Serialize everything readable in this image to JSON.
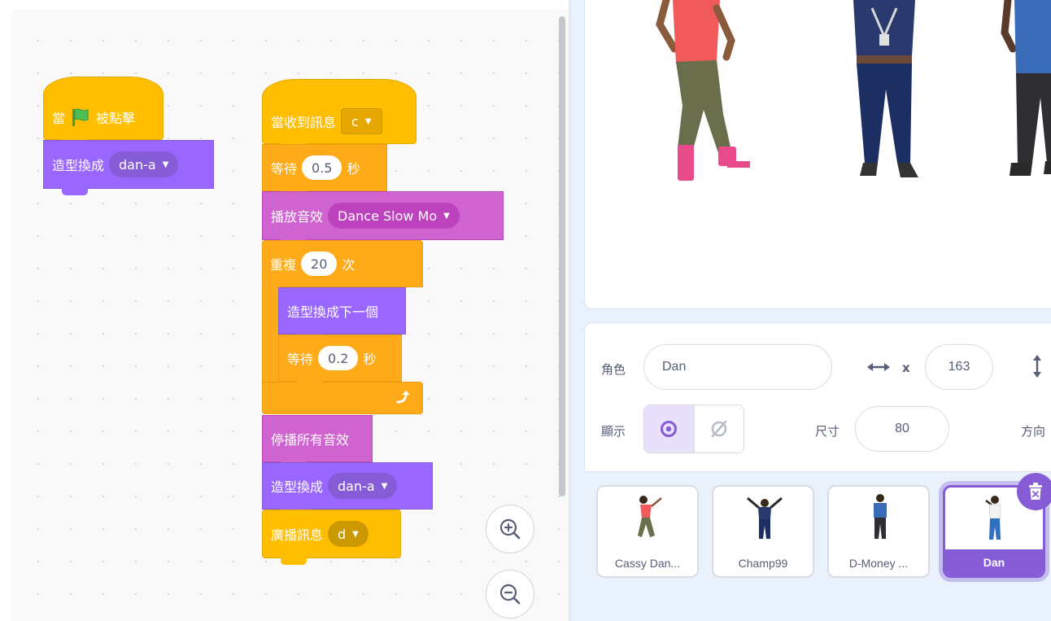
{
  "colors": {
    "events": "#ffbf00",
    "control": "#ffab19",
    "looks": "#9966ff",
    "sound": "#cf63cf",
    "selected": "#855cd6"
  },
  "script1": {
    "hat_before": "當",
    "hat_after": "被點擊",
    "switch_label": "造型換成",
    "switch_value": "dan-a"
  },
  "script2": {
    "hat_label": "當收到訊息",
    "hat_value": "c",
    "wait1_label": "等待",
    "wait1_value": "0.5",
    "wait1_unit": "秒",
    "play_label": "播放音效",
    "play_value": "Dance Slow Mo",
    "repeat_label": "重複",
    "repeat_value": "20",
    "repeat_unit": "次",
    "next_costume": "造型換成下一個",
    "wait2_label": "等待",
    "wait2_value": "0.2",
    "wait2_unit": "秒",
    "stop_sounds": "停播所有音效",
    "switch_label": "造型換成",
    "switch_value": "dan-a",
    "broadcast_label": "廣播訊息",
    "broadcast_value": "d"
  },
  "sprite_info": {
    "sprite_label": "角色",
    "sprite_name": "Dan",
    "x_label": "x",
    "x_value": "163",
    "show_label": "顯示",
    "size_label": "尺寸",
    "size_value": "80",
    "direction_label": "方向"
  },
  "sprites": [
    {
      "name": "Cassy Dan...",
      "selected": false
    },
    {
      "name": "Champ99",
      "selected": false
    },
    {
      "name": "D-Money ...",
      "selected": false
    },
    {
      "name": "Dan",
      "selected": true
    }
  ],
  "icons": {
    "zoom_in": "zoom-in-icon",
    "zoom_out": "zoom-out-icon",
    "green_flag": "green-flag-icon",
    "repeat_arrow": "repeat-arrow-icon",
    "eye": "eye-icon",
    "eye_off": "eye-off-icon",
    "delete": "trash-icon"
  }
}
